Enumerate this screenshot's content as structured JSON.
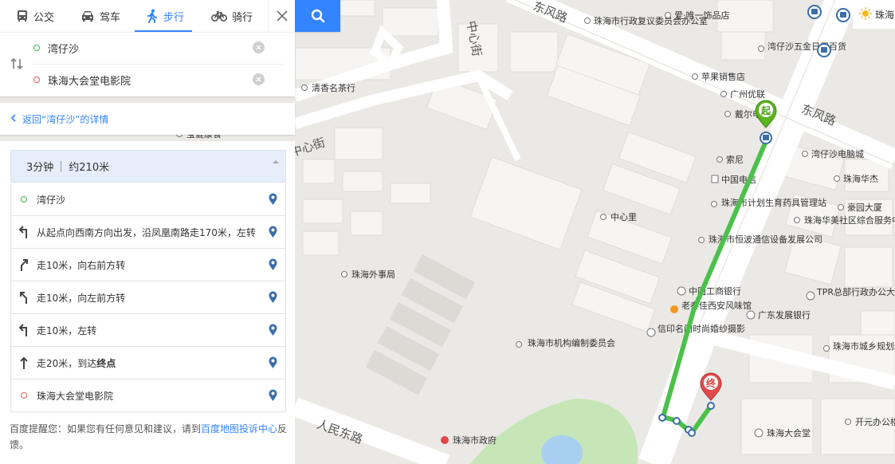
{
  "tabs": [
    {
      "label": "公交",
      "icon": "bus-icon"
    },
    {
      "label": "驾车",
      "icon": "car-icon"
    },
    {
      "label": "步行",
      "icon": "walk-icon",
      "active": true
    },
    {
      "label": "骑行",
      "icon": "bike-icon"
    }
  ],
  "route": {
    "start": "湾仔沙",
    "end": "珠海大会堂电影院"
  },
  "back_link": "返回“湾仔沙”的详情",
  "summary": {
    "duration": "3分钟",
    "distance": "约210米"
  },
  "steps": [
    {
      "text": "湾仔沙",
      "icon": "start-dot-icon"
    },
    {
      "text": "从起点向西南方向出发，沿凤凰南路走170米，左转",
      "icon": "turn-left-icon"
    },
    {
      "text": "走10米，向右前方转",
      "icon": "bear-right-icon"
    },
    {
      "text": "走10米，向左前方转",
      "icon": "bear-left-icon"
    },
    {
      "text": "走10米，左转",
      "icon": "turn-left-icon"
    },
    {
      "text_pre": "走20米，到达",
      "text_bold": "终点",
      "icon": "straight-icon"
    },
    {
      "text": "珠海大会堂电影院",
      "icon": "end-dot-icon"
    }
  ],
  "tip": {
    "prefix": "百度提醒您：如果您有任何意见和建议，请到",
    "link": "百度地图投诉中心",
    "suffix": "反馈。"
  },
  "weather": {
    "city": "珠海",
    "icon": "sun-icon"
  },
  "map": {
    "roads": [
      "东风路",
      "中心街",
      "中心街",
      "东风路",
      "人民东路"
    ],
    "markers": {
      "start": "起",
      "end": "终"
    },
    "pois": [
      "珠海市行政复议委员会办公室",
      "爱·唯一饰品店",
      "湾仔沙五金日用百货",
      "清香名茶行",
      "苹果销售店",
      "广州优联",
      "戴尔电",
      "湾仔沙电脑城",
      "索尼",
      "珠海华杰",
      "中国电信",
      "珠海市计划生育药具管理站",
      "豪园大厦",
      "中心里",
      "珠海华美社区综合服务中心",
      "珠海市恒波通信设备发展公司",
      "珠海外事局",
      "中国工商银行",
      "TPR总部行政办公大楼",
      "老秦佳西安风味馆",
      "广东发展银行",
      "信印名门时尚婚纱摄影",
      "珠海市机构编制委员会",
      "珠海市城乡规划编审与信息中",
      "珠海大会堂",
      "开元办公楼",
      "珠海市政府",
      "宝健康餐"
    ],
    "route_color": "#4cc14a",
    "accent": "#3385ff"
  }
}
